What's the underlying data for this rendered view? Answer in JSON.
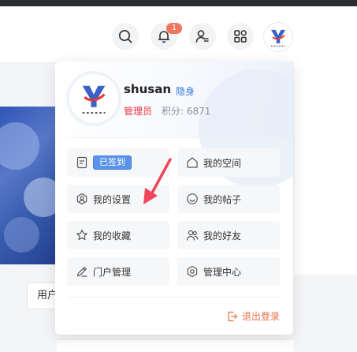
{
  "header": {
    "notification_count": "1"
  },
  "background": {
    "user_button_label": "用户"
  },
  "user": {
    "name": "shusan",
    "status": "隐身",
    "role": "管理员",
    "points": "积分: 6871"
  },
  "menu": {
    "checkin_label": "已签到",
    "items": [
      {
        "label": "我的空间"
      },
      {
        "label": "我的设置"
      },
      {
        "label": "我的帖子"
      },
      {
        "label": "我的收藏"
      },
      {
        "label": "我的好友"
      },
      {
        "label": "门户管理"
      },
      {
        "label": "管理中心"
      }
    ],
    "logout_label": "退出登录"
  },
  "colors": {
    "accent_blue": "#3e7bd8",
    "checkin_bg": "#5b93ea",
    "badge": "#f0755f",
    "role_red": "#e8333a",
    "logout_orange": "#e8704a",
    "arrow_red": "#f0455a"
  },
  "icons": {
    "search": "search-icon",
    "bell": "bell-icon",
    "user_switch": "user-switch-icon",
    "apps": "apps-grid-icon"
  }
}
